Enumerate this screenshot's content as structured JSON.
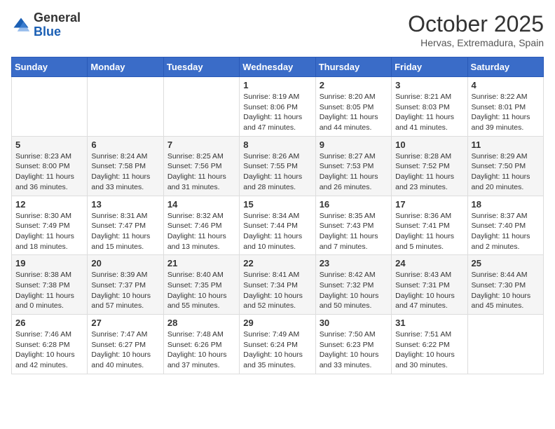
{
  "header": {
    "logo_general": "General",
    "logo_blue": "Blue",
    "month": "October 2025",
    "location": "Hervas, Extremadura, Spain"
  },
  "weekdays": [
    "Sunday",
    "Monday",
    "Tuesday",
    "Wednesday",
    "Thursday",
    "Friday",
    "Saturday"
  ],
  "weeks": [
    [
      {
        "day": "",
        "info": ""
      },
      {
        "day": "",
        "info": ""
      },
      {
        "day": "",
        "info": ""
      },
      {
        "day": "1",
        "info": "Sunrise: 8:19 AM\nSunset: 8:06 PM\nDaylight: 11 hours and 47 minutes."
      },
      {
        "day": "2",
        "info": "Sunrise: 8:20 AM\nSunset: 8:05 PM\nDaylight: 11 hours and 44 minutes."
      },
      {
        "day": "3",
        "info": "Sunrise: 8:21 AM\nSunset: 8:03 PM\nDaylight: 11 hours and 41 minutes."
      },
      {
        "day": "4",
        "info": "Sunrise: 8:22 AM\nSunset: 8:01 PM\nDaylight: 11 hours and 39 minutes."
      }
    ],
    [
      {
        "day": "5",
        "info": "Sunrise: 8:23 AM\nSunset: 8:00 PM\nDaylight: 11 hours and 36 minutes."
      },
      {
        "day": "6",
        "info": "Sunrise: 8:24 AM\nSunset: 7:58 PM\nDaylight: 11 hours and 33 minutes."
      },
      {
        "day": "7",
        "info": "Sunrise: 8:25 AM\nSunset: 7:56 PM\nDaylight: 11 hours and 31 minutes."
      },
      {
        "day": "8",
        "info": "Sunrise: 8:26 AM\nSunset: 7:55 PM\nDaylight: 11 hours and 28 minutes."
      },
      {
        "day": "9",
        "info": "Sunrise: 8:27 AM\nSunset: 7:53 PM\nDaylight: 11 hours and 26 minutes."
      },
      {
        "day": "10",
        "info": "Sunrise: 8:28 AM\nSunset: 7:52 PM\nDaylight: 11 hours and 23 minutes."
      },
      {
        "day": "11",
        "info": "Sunrise: 8:29 AM\nSunset: 7:50 PM\nDaylight: 11 hours and 20 minutes."
      }
    ],
    [
      {
        "day": "12",
        "info": "Sunrise: 8:30 AM\nSunset: 7:49 PM\nDaylight: 11 hours and 18 minutes."
      },
      {
        "day": "13",
        "info": "Sunrise: 8:31 AM\nSunset: 7:47 PM\nDaylight: 11 hours and 15 minutes."
      },
      {
        "day": "14",
        "info": "Sunrise: 8:32 AM\nSunset: 7:46 PM\nDaylight: 11 hours and 13 minutes."
      },
      {
        "day": "15",
        "info": "Sunrise: 8:34 AM\nSunset: 7:44 PM\nDaylight: 11 hours and 10 minutes."
      },
      {
        "day": "16",
        "info": "Sunrise: 8:35 AM\nSunset: 7:43 PM\nDaylight: 11 hours and 7 minutes."
      },
      {
        "day": "17",
        "info": "Sunrise: 8:36 AM\nSunset: 7:41 PM\nDaylight: 11 hours and 5 minutes."
      },
      {
        "day": "18",
        "info": "Sunrise: 8:37 AM\nSunset: 7:40 PM\nDaylight: 11 hours and 2 minutes."
      }
    ],
    [
      {
        "day": "19",
        "info": "Sunrise: 8:38 AM\nSunset: 7:38 PM\nDaylight: 11 hours and 0 minutes."
      },
      {
        "day": "20",
        "info": "Sunrise: 8:39 AM\nSunset: 7:37 PM\nDaylight: 10 hours and 57 minutes."
      },
      {
        "day": "21",
        "info": "Sunrise: 8:40 AM\nSunset: 7:35 PM\nDaylight: 10 hours and 55 minutes."
      },
      {
        "day": "22",
        "info": "Sunrise: 8:41 AM\nSunset: 7:34 PM\nDaylight: 10 hours and 52 minutes."
      },
      {
        "day": "23",
        "info": "Sunrise: 8:42 AM\nSunset: 7:32 PM\nDaylight: 10 hours and 50 minutes."
      },
      {
        "day": "24",
        "info": "Sunrise: 8:43 AM\nSunset: 7:31 PM\nDaylight: 10 hours and 47 minutes."
      },
      {
        "day": "25",
        "info": "Sunrise: 8:44 AM\nSunset: 7:30 PM\nDaylight: 10 hours and 45 minutes."
      }
    ],
    [
      {
        "day": "26",
        "info": "Sunrise: 7:46 AM\nSunset: 6:28 PM\nDaylight: 10 hours and 42 minutes."
      },
      {
        "day": "27",
        "info": "Sunrise: 7:47 AM\nSunset: 6:27 PM\nDaylight: 10 hours and 40 minutes."
      },
      {
        "day": "28",
        "info": "Sunrise: 7:48 AM\nSunset: 6:26 PM\nDaylight: 10 hours and 37 minutes."
      },
      {
        "day": "29",
        "info": "Sunrise: 7:49 AM\nSunset: 6:24 PM\nDaylight: 10 hours and 35 minutes."
      },
      {
        "day": "30",
        "info": "Sunrise: 7:50 AM\nSunset: 6:23 PM\nDaylight: 10 hours and 33 minutes."
      },
      {
        "day": "31",
        "info": "Sunrise: 7:51 AM\nSunset: 6:22 PM\nDaylight: 10 hours and 30 minutes."
      },
      {
        "day": "",
        "info": ""
      }
    ]
  ]
}
